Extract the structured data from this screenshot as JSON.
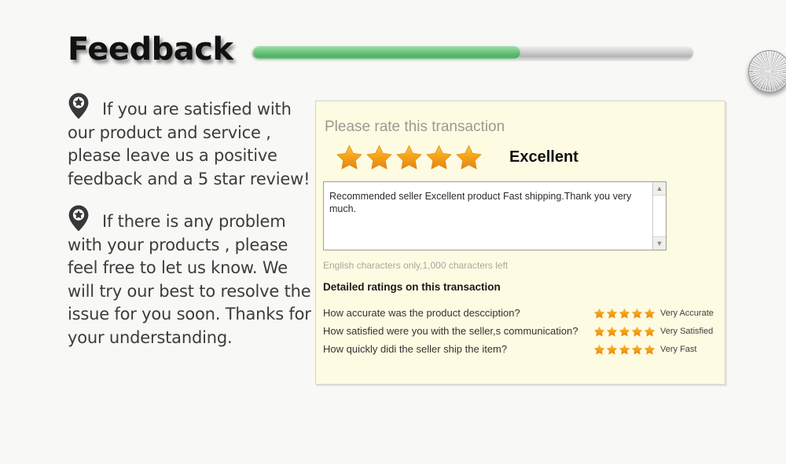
{
  "page": {
    "background_color": "#f8f8f6"
  },
  "header": {
    "title": "Feedback",
    "slider": {
      "fill_color": "#5ebd72",
      "track_color": "#cfcfcf",
      "value_percent": 61
    }
  },
  "left_column": {
    "notes": [
      {
        "icon": "location-pin-star-icon",
        "text": "If you are satisfied with our product and service , please leave us a positive feedback and a 5 star review!"
      },
      {
        "icon": "location-pin-star-icon",
        "text": "If there is any problem with your products , please feel free to let us know. We will try our best to resolve the issue for you soon. Thanks for your understanding."
      }
    ]
  },
  "rating_panel": {
    "background_color": "#fdfbe2",
    "border_color": "#d5d2c6",
    "prompt": "Please rate this transaction",
    "overall_stars": 5,
    "overall_stars_filled": 5,
    "star_color": "#f2a01e",
    "verdict": "Excellent",
    "comment": {
      "value": "Recommended seller Excellent product Fast shipping.Thank you very much.",
      "placeholder": "",
      "scroll_up_icon": "chevron-up-icon",
      "scroll_down_icon": "chevron-down-icon"
    },
    "char_hint": "English characters only,1,000 characters left",
    "section_heading": "Detailed ratings on this transaction",
    "detail_ratings": [
      {
        "question": "How accurate was the product descciption?",
        "stars": 5,
        "label": "Very Accurate"
      },
      {
        "question": "How satisfied were you with the seller,s communication?",
        "stars": 5,
        "label": "Very Satisfied"
      },
      {
        "question": "How quickly didi the seller ship the item?",
        "stars": 5,
        "label": "Very Fast"
      }
    ]
  }
}
